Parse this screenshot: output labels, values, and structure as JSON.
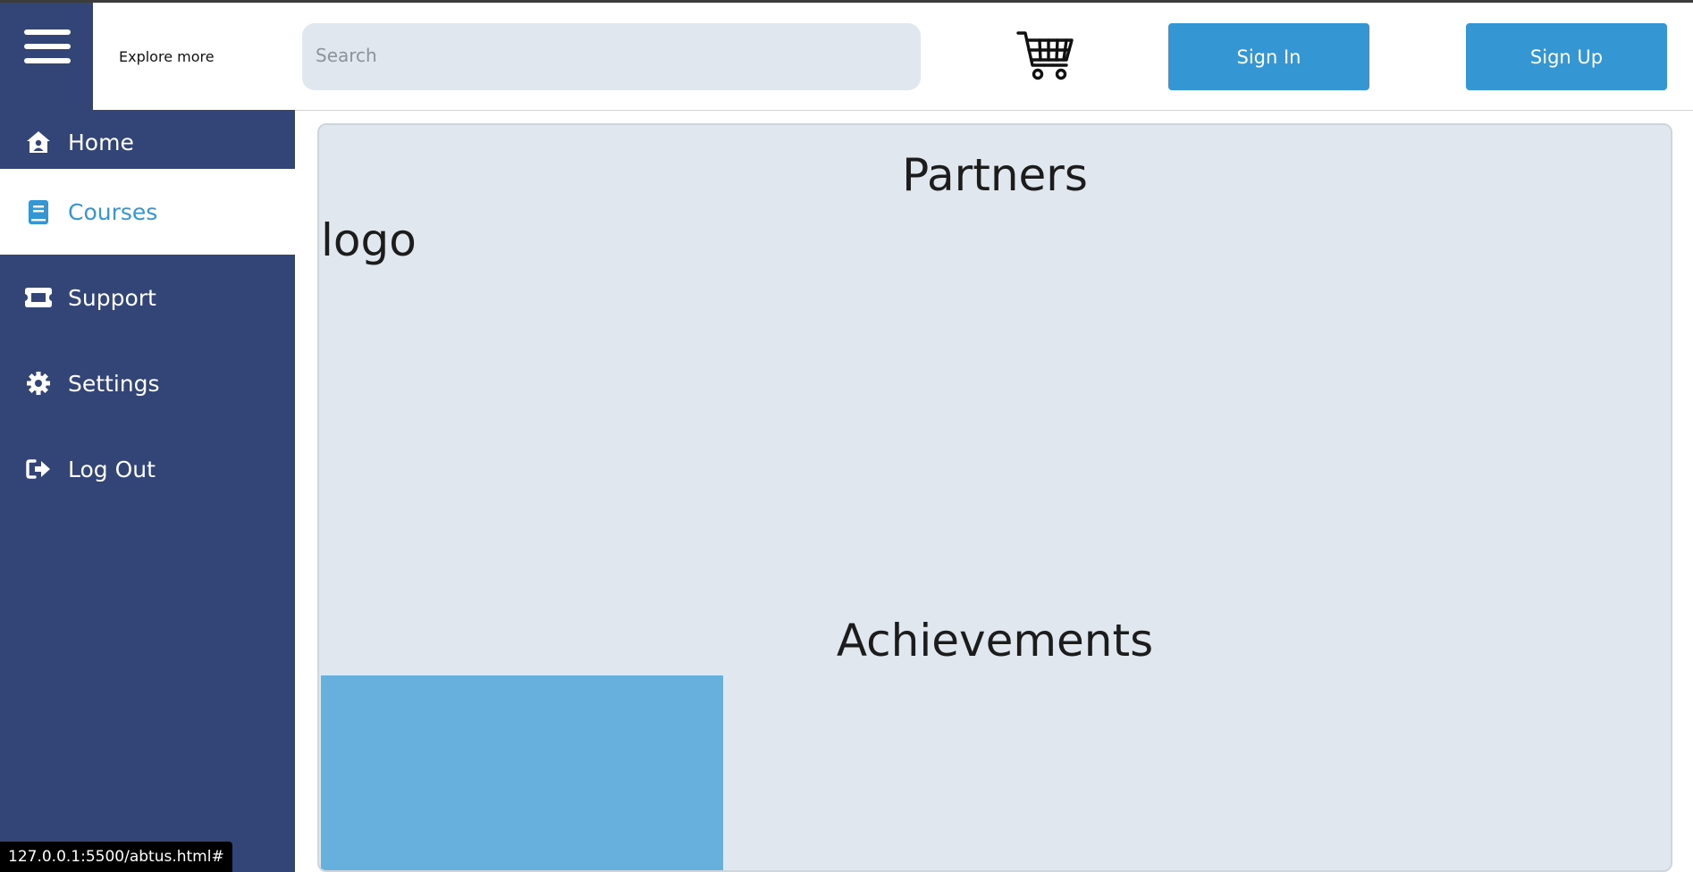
{
  "header": {
    "explore_label": "Explore more",
    "search_placeholder": "Search",
    "signin_label": "Sign In",
    "signup_label": "Sign Up"
  },
  "sidebar": {
    "items": [
      {
        "label": "Home",
        "icon": "home-icon"
      },
      {
        "label": "Courses",
        "icon": "book-icon"
      },
      {
        "label": "Support",
        "icon": "ticket-icon"
      },
      {
        "label": "Settings",
        "icon": "gear-icon"
      },
      {
        "label": "Log Out",
        "icon": "logout-icon"
      }
    ]
  },
  "main": {
    "partners_heading": "Partners",
    "logo_placeholder": "logo",
    "achievements_heading": "Achievements"
  },
  "status_url": "127.0.0.1:5500/abtus.html#",
  "colors": {
    "sidebar_bg": "#324576",
    "accent": "#3497d4",
    "panel_bg": "#e0e7ee",
    "block_blue": "#67b0de"
  }
}
